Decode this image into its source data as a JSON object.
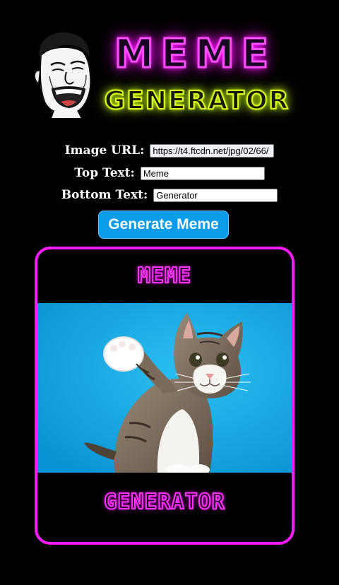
{
  "logo": {
    "line1": "MEME",
    "line2": "GENERATOR",
    "line1_color": "#ff4dff",
    "line2_color": "#dfff20",
    "mascot_icon": "laughing-meme-face-icon"
  },
  "form": {
    "image_url": {
      "label": "Image URL:",
      "value": "https://t4.ftcdn.net/jpg/02/66/"
    },
    "top_text": {
      "label": "Top Text:",
      "value": "Meme"
    },
    "bottom_text": {
      "label": "Bottom Text:",
      "value": "Generator"
    },
    "submit_label": "Generate Meme",
    "submit_color": "#0d9ce9"
  },
  "meme": {
    "top_text": "MEME",
    "bottom_text": "GENERATOR",
    "border_color": "#ff1aff",
    "image_subject": "cat-raising-paw-on-blue-background"
  }
}
